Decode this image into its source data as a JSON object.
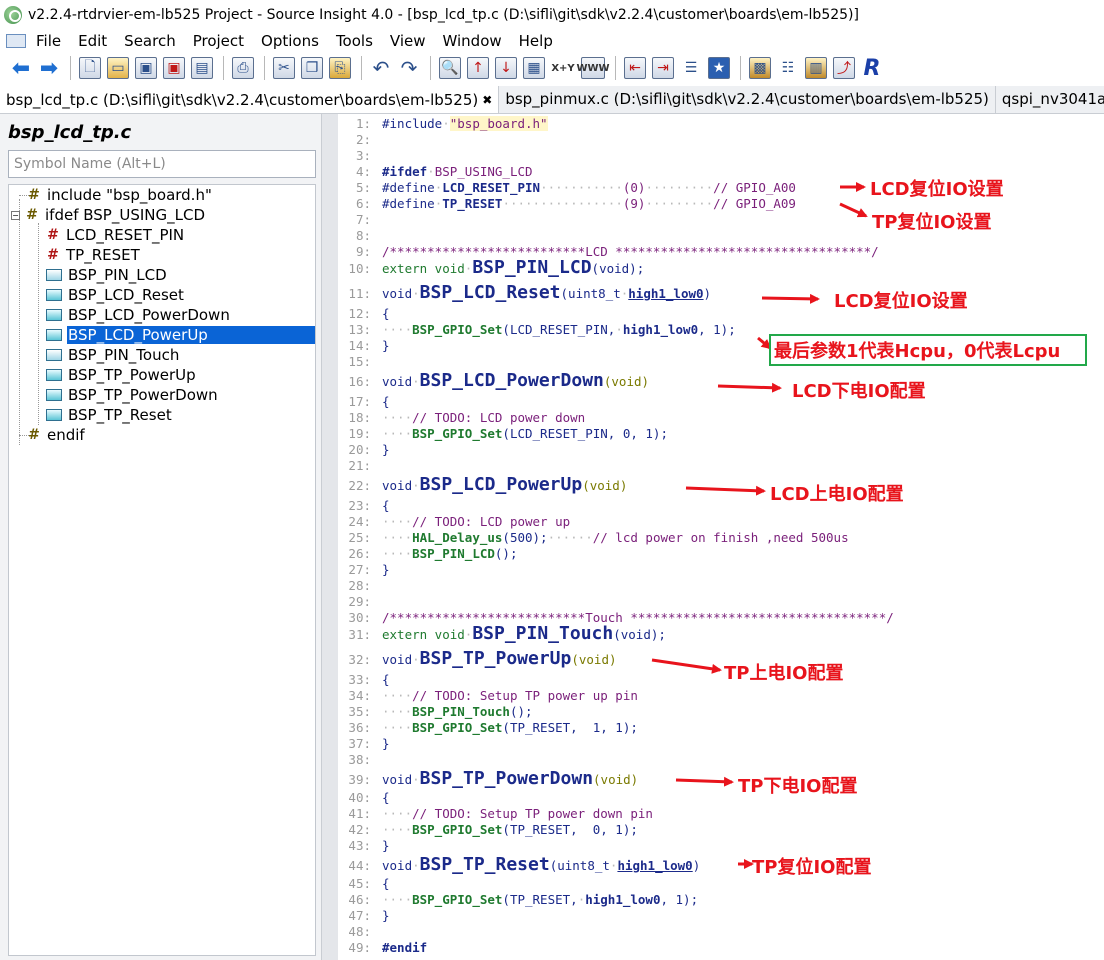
{
  "window": {
    "title": "v2.2.4-rtdrvier-em-lb525 Project - Source Insight 4.0 - [bsp_lcd_tp.c (D:\\sifli\\git\\sdk\\v2.2.4\\customer\\boards\\em-lb525)]"
  },
  "menu": [
    "File",
    "Edit",
    "Search",
    "Project",
    "Options",
    "Tools",
    "View",
    "Window",
    "Help"
  ],
  "toolbar": {
    "icons": [
      "back-arrow-icon",
      "forward-arrow-icon",
      "new-file-icon",
      "open-folder-icon",
      "save-icon",
      "save-as-icon",
      "save-all-icon",
      "print-icon",
      "cut-icon",
      "copy-icon",
      "paste-icon",
      "undo-icon",
      "redo-icon",
      "find-icon",
      "jump-up-icon",
      "jump-down-icon",
      "browse-icon",
      "xy-icon",
      "www-icon",
      "bookmark-prev-icon",
      "bookmark-next-icon",
      "outline-icon",
      "star-icon",
      "project-icon",
      "context-icon",
      "book-icon",
      "relation-icon",
      "r-icon"
    ],
    "xy_label": "X+Y",
    "www_label": "WWW"
  },
  "tabs": [
    {
      "label": "bsp_lcd_tp.c (D:\\sifli\\git\\sdk\\v2.2.4\\customer\\boards\\em-lb525)",
      "active": true,
      "close": "✖"
    },
    {
      "label": "bsp_pinmux.c (D:\\sifli\\git\\sdk\\v2.2.4\\customer\\boards\\em-lb525)",
      "active": false
    },
    {
      "label": "qspi_nv3041a.",
      "active": false
    }
  ],
  "symbol_panel": {
    "file_title": "bsp_lcd_tp.c",
    "search_placeholder": "Symbol Name (Alt+L)",
    "items": [
      {
        "label": "include \"bsp_board.h\"",
        "icon": "hash-icon"
      },
      {
        "label": "ifdef BSP_USING_LCD",
        "icon": "hash-icon",
        "expander": "−"
      },
      {
        "label": "LCD_RESET_PIN",
        "icon": "macro-icon"
      },
      {
        "label": "TP_RESET",
        "icon": "macro-icon"
      },
      {
        "label": "BSP_PIN_LCD",
        "icon": "prototype-icon"
      },
      {
        "label": "BSP_LCD_Reset",
        "icon": "function-icon"
      },
      {
        "label": "BSP_LCD_PowerDown",
        "icon": "function-icon"
      },
      {
        "label": "BSP_LCD_PowerUp",
        "icon": "function-icon",
        "selected": true
      },
      {
        "label": "BSP_PIN_Touch",
        "icon": "prototype-icon"
      },
      {
        "label": "BSP_TP_PowerUp",
        "icon": "function-icon"
      },
      {
        "label": "BSP_TP_PowerDown",
        "icon": "function-icon"
      },
      {
        "label": "BSP_TP_Reset",
        "icon": "function-icon"
      },
      {
        "label": "endif",
        "icon": "hash-icon"
      }
    ]
  },
  "code": {
    "line_numbers": [
      "1:",
      "2:",
      "3:",
      "4:",
      "5:",
      "6:",
      "7:",
      "8:",
      "9:",
      "10:",
      "11:",
      "12:",
      "13:",
      "14:",
      "15:",
      "16:",
      "17:",
      "18:",
      "19:",
      "20:",
      "21:",
      "22:",
      "23:",
      "24:",
      "25:",
      "26:",
      "27:",
      "28:",
      "29:",
      "30:",
      "31:",
      "32:",
      "33:",
      "34:",
      "35:",
      "36:",
      "37:",
      "38:",
      "39:",
      "40:",
      "41:",
      "42:",
      "43:",
      "44:",
      "45:",
      "46:",
      "47:",
      "48:",
      "49:"
    ],
    "include_kw": "#include",
    "include_file": "\"bsp_board.h\"",
    "ifdef_kw": "#ifdef",
    "ifdef_macro": "BSP_USING_LCD",
    "define_kw": "#define",
    "lcd_reset_pin": "LCD_RESET_PIN",
    "lcd_reset_val": "(0)",
    "lcd_reset_comment": "// GPIO_A00",
    "tp_reset": "TP_RESET",
    "tp_reset_val": "(9)",
    "tp_reset_comment": "// GPIO_A09",
    "lcd_banner": "/**************************LCD **********************************/",
    "touch_banner": "/**************************Touch **********************************/",
    "extern_void": "extern void",
    "void": "void",
    "bsp_pin_lcd": "BSP_PIN_LCD",
    "bsp_pin_touch": "BSP_PIN_Touch",
    "proto_args": "(void);",
    "void_args": "(void)",
    "bsp_lcd_reset": "BSP_LCD_Reset",
    "uint8_open": "(uint8_t",
    "high1_low0": "high1_low0",
    "close_paren": ")",
    "open_brace": "{",
    "close_brace": "}",
    "gpio_set": "BSP_GPIO_Set",
    "lcd_reset_args_a": "(LCD_RESET_PIN,",
    "lcd_reset_args_b": ", 1);",
    "bsp_lcd_powerdown": "BSP_LCD_PowerDown",
    "todo_lcd_down": "// TODO: LCD power down",
    "powerdown_args": "(LCD_RESET_PIN, 0, 1);",
    "bsp_lcd_powerup": "BSP_LCD_PowerUp",
    "todo_lcd_up": "// TODO: LCD power up",
    "hal_delay": "HAL_Delay_us",
    "delay_args": "(500);",
    "delay_comment": "// lcd power on finish ,need 500us",
    "pin_lcd_call_args": "();",
    "bsp_tp_powerup": "BSP_TP_PowerUp",
    "todo_tp_up": "// TODO: Setup TP power up pin",
    "tp_up_args": "(TP_RESET,  1, 1);",
    "bsp_tp_powerdown": "BSP_TP_PowerDown",
    "todo_tp_down": "// TODO: Setup TP power down pin",
    "tp_down_args": "(TP_RESET,  0, 1);",
    "bsp_tp_reset": "BSP_TP_Reset",
    "tp_reset_args_a": "(TP_RESET,",
    "endif_kw": "#endif"
  },
  "annotations": {
    "lcd_reset_io": "LCD复位IO设置",
    "tp_reset_io": "TP复位IO设置",
    "lcd_reset_fn": "LCD复位IO设置",
    "param_note": "最后参数1代表Hcpu，0代表Lcpu",
    "lcd_powerdown": "LCD下电IO配置",
    "lcd_powerup": "LCD上电IO配置",
    "tp_powerup": "TP上电IO配置",
    "tp_powerdown": "TP下电IO配置",
    "tp_reset_fn": "TP复位IO配置",
    "arrow_color": "#e8141c",
    "box_color": "#22a84a"
  }
}
